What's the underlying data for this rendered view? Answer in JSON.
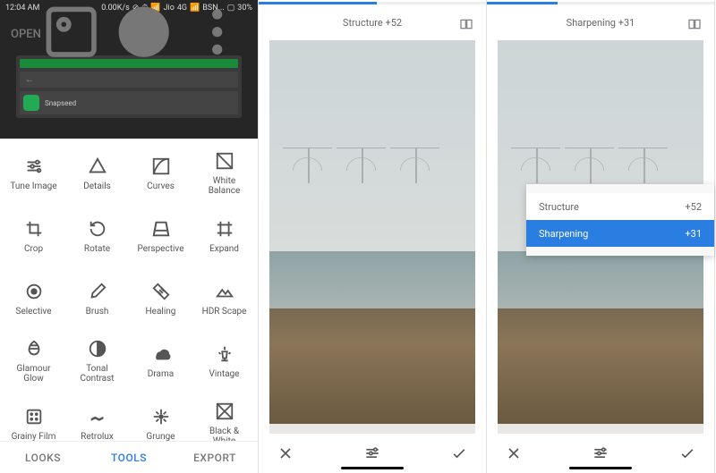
{
  "status": {
    "time": "12:04 AM",
    "speed": "0.00K/s",
    "carrier1": "Jio",
    "net": "4G",
    "carrier2": "BSN...",
    "battery": "30%"
  },
  "header": {
    "title": "OPEN"
  },
  "tools": [
    {
      "id": "tune",
      "label": "Tune Image"
    },
    {
      "id": "details",
      "label": "Details"
    },
    {
      "id": "curves",
      "label": "Curves"
    },
    {
      "id": "white-balance",
      "label": "White\nBalance"
    },
    {
      "id": "crop",
      "label": "Crop"
    },
    {
      "id": "rotate",
      "label": "Rotate"
    },
    {
      "id": "perspective",
      "label": "Perspective"
    },
    {
      "id": "expand",
      "label": "Expand"
    },
    {
      "id": "selective",
      "label": "Selective"
    },
    {
      "id": "brush",
      "label": "Brush"
    },
    {
      "id": "healing",
      "label": "Healing"
    },
    {
      "id": "hdr",
      "label": "HDR Scape"
    },
    {
      "id": "glamour",
      "label": "Glamour\nGlow"
    },
    {
      "id": "tonal",
      "label": "Tonal\nContrast"
    },
    {
      "id": "drama",
      "label": "Drama"
    },
    {
      "id": "vintage",
      "label": "Vintage"
    },
    {
      "id": "grainy",
      "label": "Grainy Film"
    },
    {
      "id": "retrolux",
      "label": "Retrolux"
    },
    {
      "id": "grunge",
      "label": "Grunge"
    },
    {
      "id": "bw",
      "label": "Black &\nWhite"
    }
  ],
  "tabs": {
    "looks": "LOOKS",
    "tools": "TOOLS",
    "export": "EXPORT"
  },
  "pane2": {
    "label": "Structure",
    "value": "+52",
    "slider_pct": 52
  },
  "pane3": {
    "label": "Sharpening",
    "value": "+31",
    "slider_pct": 31,
    "popup": [
      {
        "name": "Structure",
        "value": "+52"
      },
      {
        "name": "Sharpening",
        "value": "+31"
      }
    ]
  },
  "app_result": {
    "name": "Snapseed"
  }
}
